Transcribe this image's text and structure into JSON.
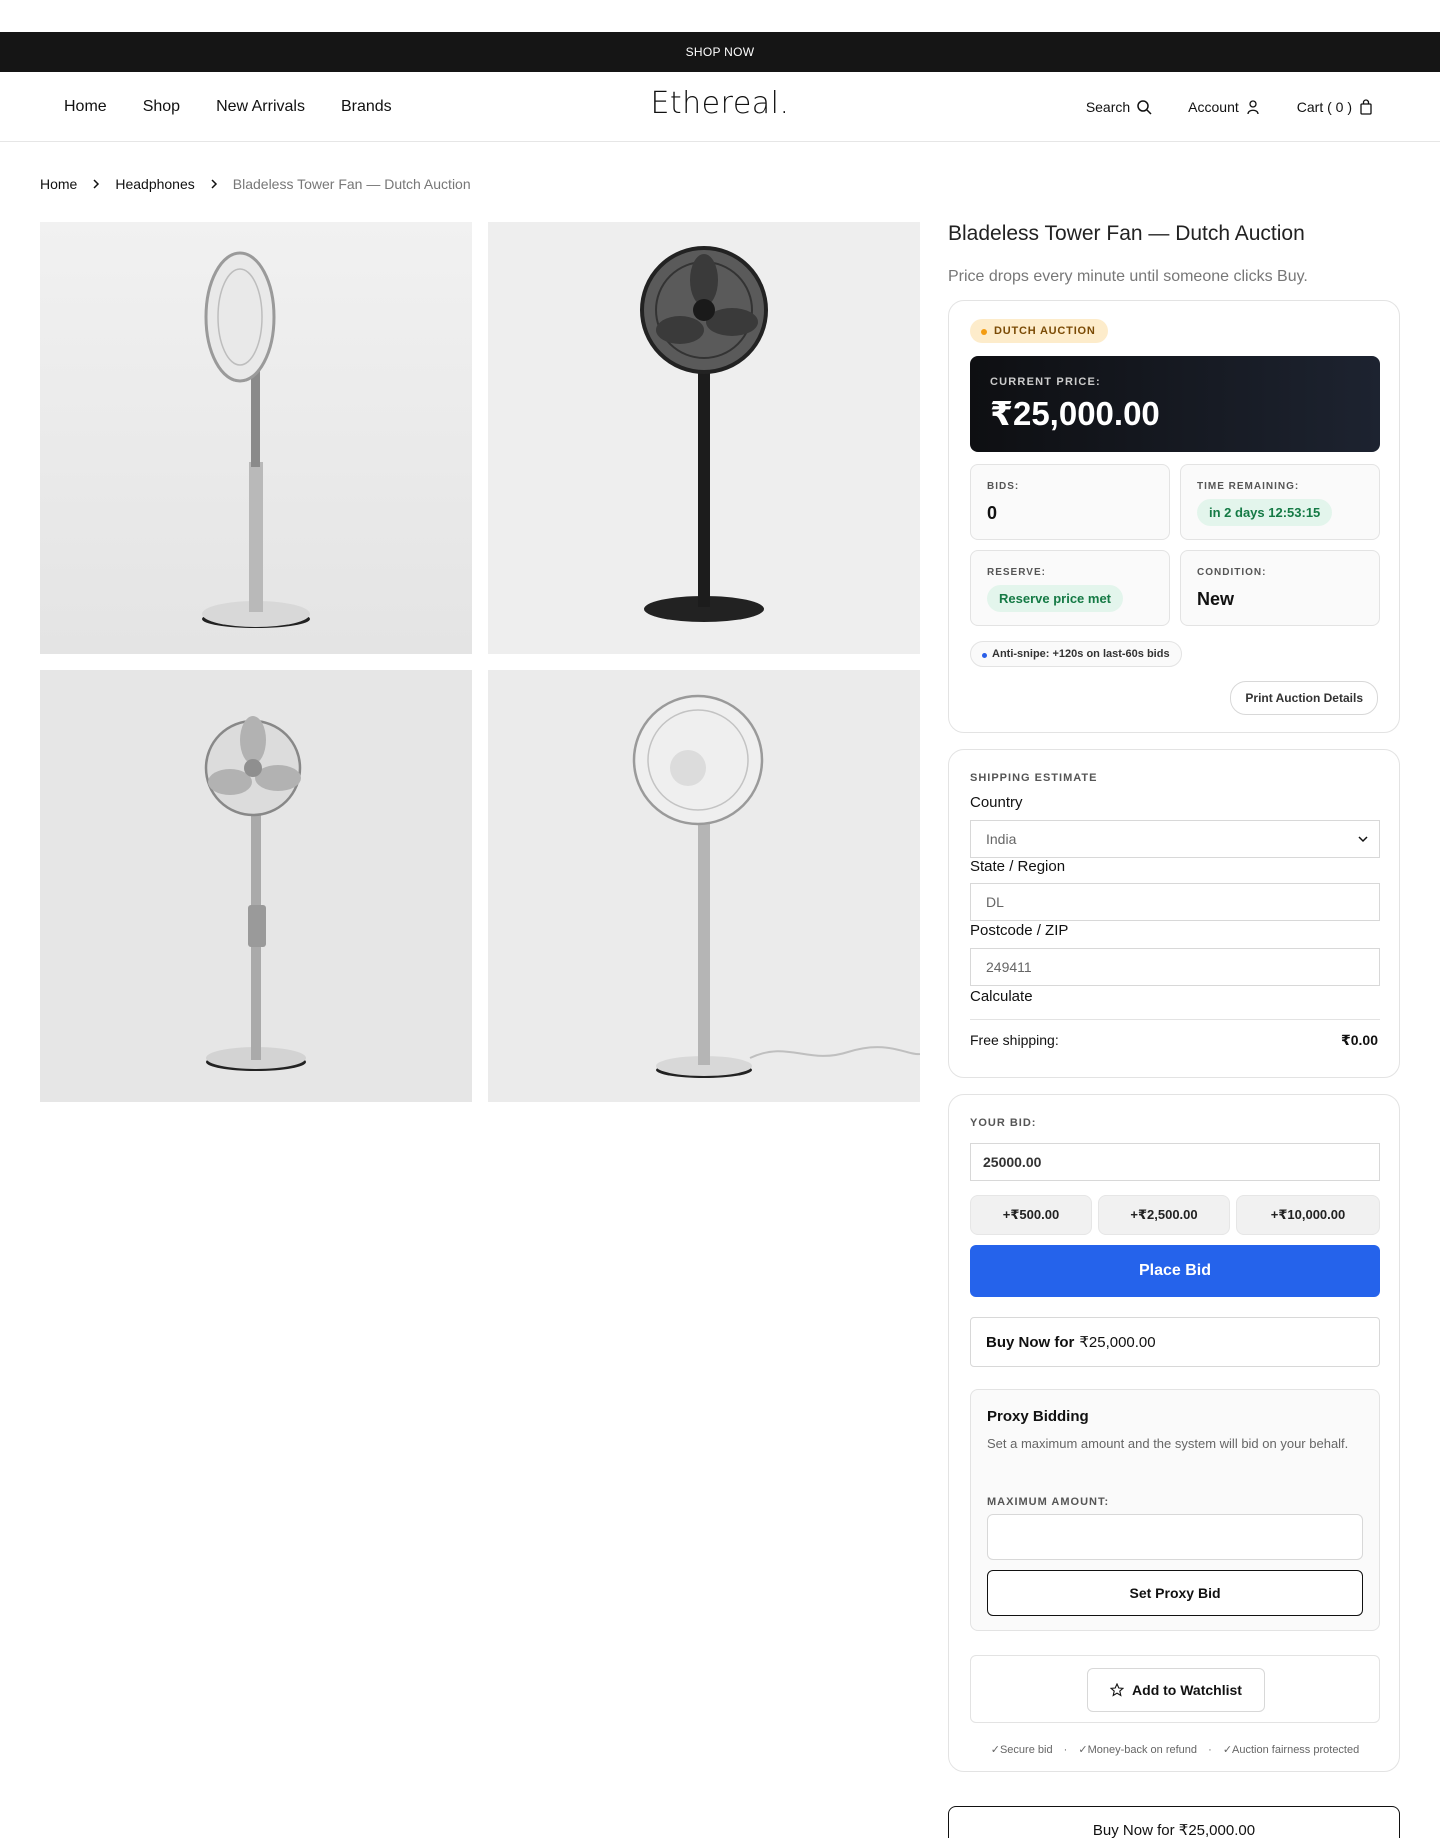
{
  "promo": {
    "text": "SHOP NOW"
  },
  "header": {
    "nav": [
      "Home",
      "Shop",
      "New Arrivals",
      "Brands"
    ],
    "logo": "Ethereal.",
    "search": "Search",
    "account": "Account",
    "cart": "Cart ( 0 )"
  },
  "breadcrumb": [
    "Home",
    "Headphones",
    "Bladeless Tower Fan — Dutch Auction"
  ],
  "gallery": {
    "images": [
      "silver-standing-fan-side-view",
      "black-standing-fan-front-view",
      "silver-standing-fan-with-remote",
      "silver-standing-fan-with-cord"
    ]
  },
  "product": {
    "title": "Bladeless Tower Fan — Dutch Auction",
    "subtitle": "Price drops every minute until someone clicks Buy."
  },
  "auction": {
    "badge": "DUTCH AUCTION",
    "current_price_label": "CURRENT PRICE:",
    "current_price": "₹25,000.00",
    "bids_label": "BIDS:",
    "bids": "0",
    "time_label": "TIME REMAINING:",
    "time": "in 2 days 12:53:15",
    "reserve_label": "RESERVE:",
    "reserve": "Reserve price met",
    "condition_label": "CONDITION:",
    "condition": "New",
    "anti_snipe": "Anti-snipe: +120s on last-60s bids",
    "print": "Print Auction Details"
  },
  "shipping": {
    "title": "SHIPPING ESTIMATE",
    "country_label": "Country",
    "country": "India",
    "state_label": "State / Region",
    "state_placeholder": "DL",
    "postcode_label": "Postcode / ZIP",
    "postcode_placeholder": "249411",
    "calculate": "Calculate",
    "free_label": "Free shipping:",
    "free_value": "₹0.00"
  },
  "bid": {
    "label": "YOUR BID:",
    "value": "25000.00",
    "increments": [
      "+₹500.00",
      "+₹2,500.00",
      "+₹10,000.00"
    ],
    "place": "Place Bid",
    "buy_now_bold": "Buy Now for",
    "buy_now_price": "₹25,000.00",
    "proxy_title": "Proxy Bidding",
    "proxy_desc": "Set a maximum amount and the system will bid on your behalf.",
    "proxy_max_label": "MAXIMUM AMOUNT:",
    "proxy_button": "Set Proxy Bid",
    "watchlist": "Add to Watchlist",
    "trust": [
      "✓Secure bid",
      "·",
      "✓Money-back on refund",
      "·",
      "✓Auction fairness protected"
    ],
    "bottom_buy": "Buy Now for ₹25,000.00"
  },
  "colors": {
    "accent": "#2563eb",
    "badge_bg": "#fdeccb",
    "dark_panel": "#151515",
    "green": "#157a45"
  }
}
